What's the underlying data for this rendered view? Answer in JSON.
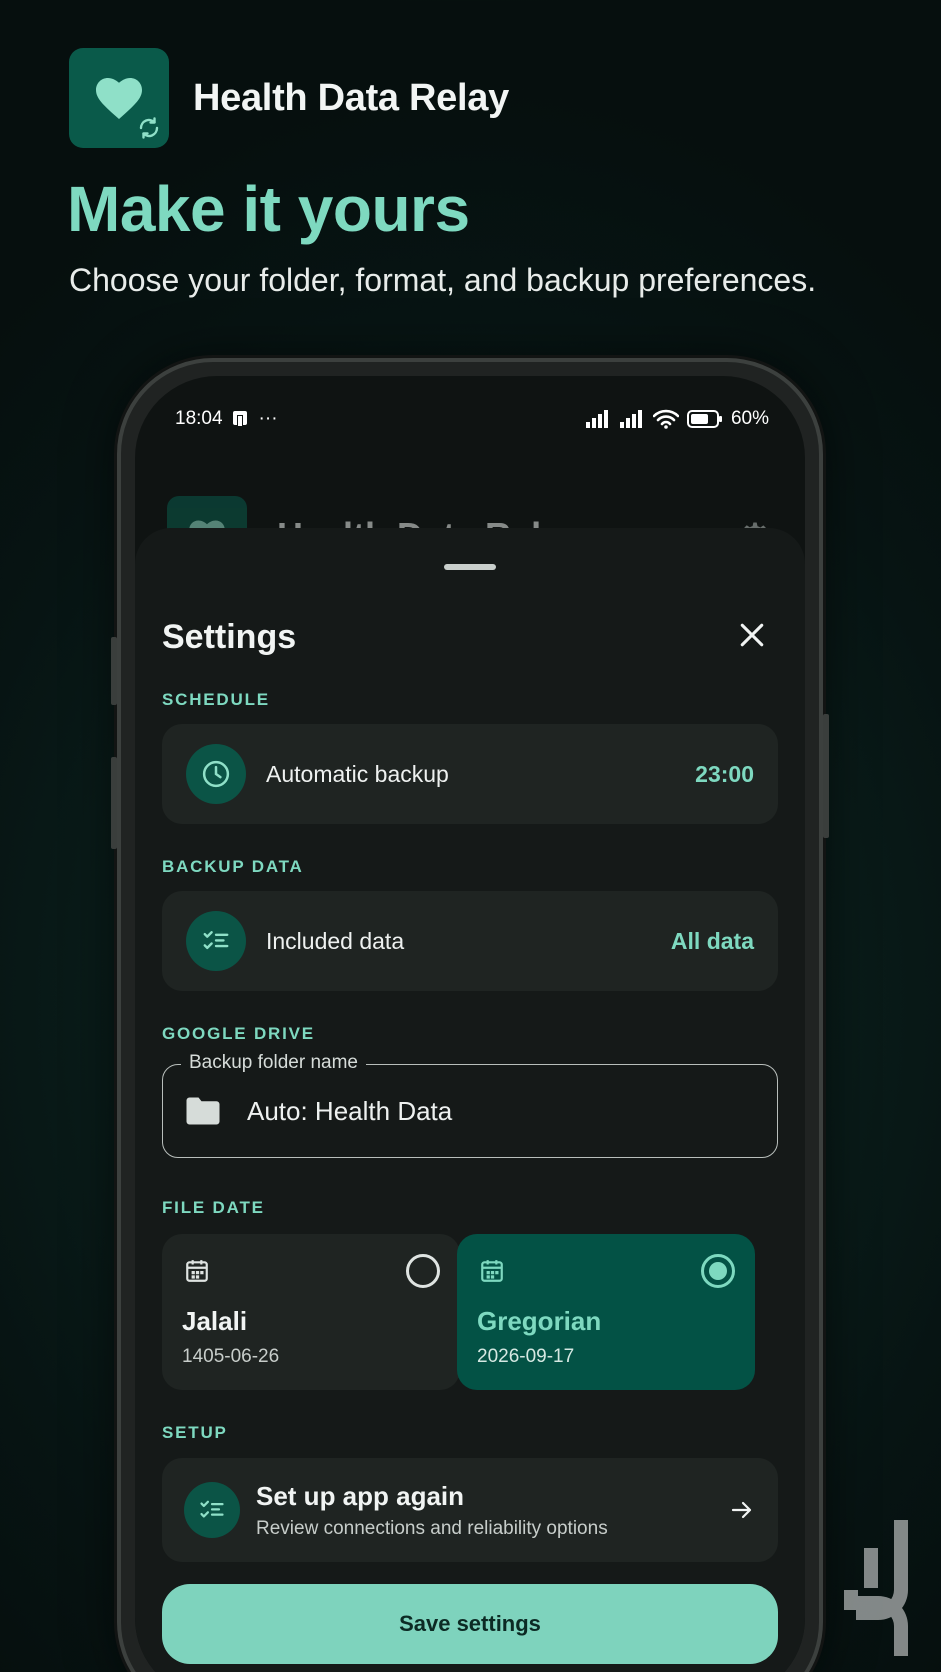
{
  "promo": {
    "app_name": "Health Data Relay",
    "headline": "Make it yours",
    "subhead": "Choose your folder, format, and backup preferences."
  },
  "status_bar": {
    "time": "18:04",
    "battery": "60%"
  },
  "app_header": {
    "title": "Health Data Relay"
  },
  "sheet": {
    "title": "Settings",
    "sections": {
      "schedule": "SCHEDULE",
      "backup_data": "BACKUP DATA",
      "google_drive": "GOOGLE DRIVE",
      "file_date": "FILE DATE",
      "setup": "SETUP"
    },
    "automatic_backup": {
      "label": "Automatic backup",
      "value": "23:00"
    },
    "included_data": {
      "label": "Included data",
      "value": "All data"
    },
    "folder": {
      "legend": "Backup folder name",
      "value": "Auto: Health Data"
    },
    "date_formats": [
      {
        "name": "Jalali",
        "sample": "1405-06-26",
        "selected": false
      },
      {
        "name": "Gregorian",
        "sample": "2026-09-17",
        "selected": true
      }
    ],
    "setup": {
      "title": "Set up app again",
      "subtitle": "Review connections and reliability options"
    },
    "save_label": "Save settings"
  },
  "colors": {
    "accent": "#7ed9c0",
    "brand_dark": "#0a5a4a",
    "selected_card": "#035245",
    "background": "#0a1e1b"
  },
  "icons": [
    "heart-icon",
    "sync-icon",
    "clock-icon",
    "checklist-icon",
    "folder-icon",
    "calendar-icon",
    "close-icon",
    "arrow-right-icon",
    "gear-icon",
    "signal-icon",
    "wifi-icon",
    "battery-icon"
  ]
}
